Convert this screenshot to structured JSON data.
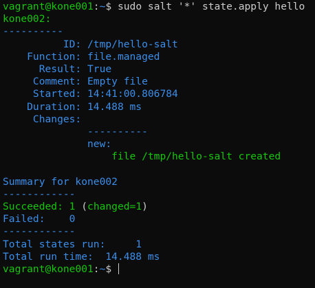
{
  "prompt": {
    "user_host": "vagrant@kone001",
    "separator": ":",
    "path": "~",
    "symbol": "$"
  },
  "command": " sudo salt '*' state.apply hello",
  "minion": "kone002:",
  "rule_short": "----------",
  "state": {
    "id_label": "          ID: ",
    "id_value": "/tmp/hello-salt",
    "function_label": "    Function: ",
    "function_value": "file.managed",
    "result_label": "      Result: ",
    "result_value": "True",
    "comment_label": "     Comment: ",
    "comment_value": "Empty file",
    "started_label": "     Started: ",
    "started_value": "14:41:00.806784",
    "duration_label": "    Duration: ",
    "duration_value": "14.488 ms",
    "changes_label": "     Changes: ",
    "changes_rule": "              ----------",
    "new_label": "              new:",
    "new_value": "                  file /tmp/hello-salt created"
  },
  "summary": {
    "title": "Summary for kone002",
    "rule": "------------",
    "succeeded_label": "Succeeded: 1 ",
    "succeeded_paren_open": "(",
    "succeeded_changed": "changed=1",
    "succeeded_paren_close": ")",
    "failed_label": "Failed:    0",
    "total_states_label": "Total states run:     1",
    "total_time_label": "Total run time:  14.488 ms"
  },
  "colors": {
    "background": "#0c0c0c",
    "prompt_green": "#16c60c",
    "path_blue": "#3b8eea",
    "text": "#cccccc"
  }
}
